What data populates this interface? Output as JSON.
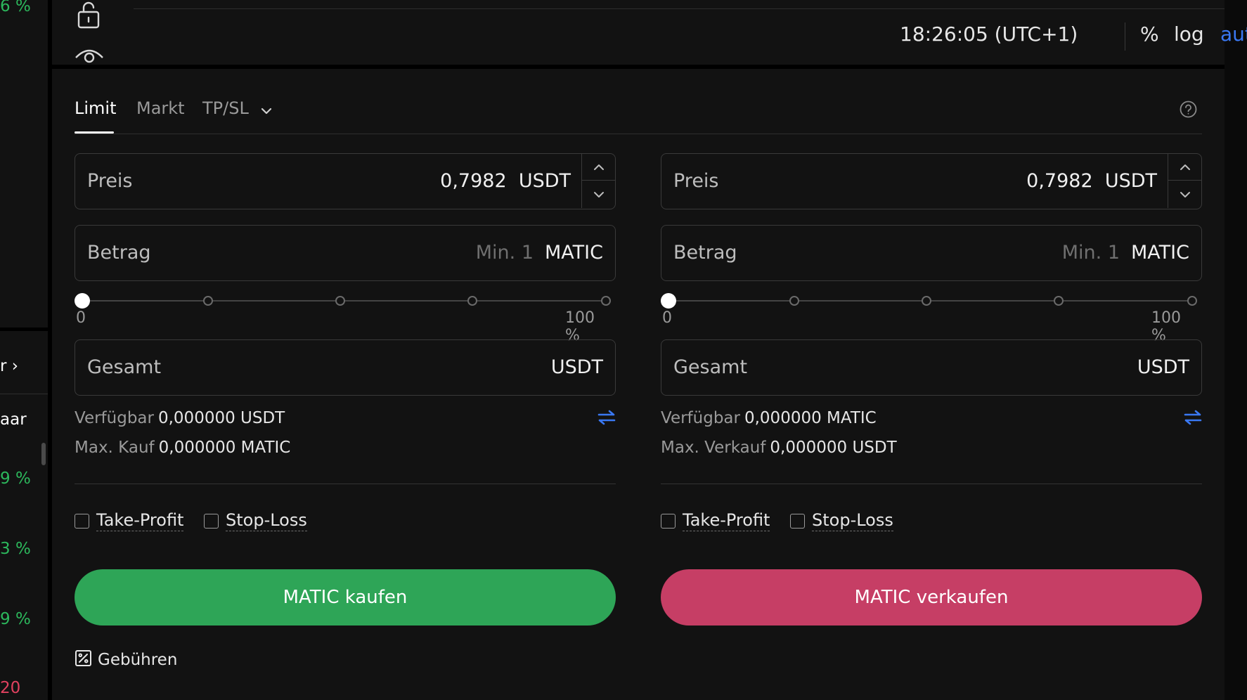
{
  "left_strip": {
    "items": [
      {
        "text": "6 %",
        "color": "green"
      },
      {
        "text": "r ›",
        "color": "white"
      },
      {
        "text": "aar",
        "color": "white"
      },
      {
        "text": "9 %",
        "color": "green"
      },
      {
        "text": "3 %",
        "color": "green"
      },
      {
        "text": "9 %",
        "color": "green"
      },
      {
        "text": "20",
        "color": "red"
      }
    ]
  },
  "topbar": {
    "time": "18:26:05 (UTC+1)",
    "options": [
      "%",
      "log",
      "auto"
    ],
    "active_option": "auto",
    "icons": [
      "unlock-icon",
      "eye-icon"
    ]
  },
  "tabs": {
    "items": [
      "Limit",
      "Markt",
      "TP/SL"
    ],
    "active": "Limit",
    "help_icon": "help-icon"
  },
  "buy": {
    "price": {
      "label": "Preis",
      "value": "0,7982",
      "unit": "USDT"
    },
    "amount": {
      "label": "Betrag",
      "placeholder": "Min. 1",
      "unit": "MATIC"
    },
    "slider": {
      "min_label": "0",
      "max_label": "100 %",
      "value_percent": 0
    },
    "total": {
      "label": "Gesamt",
      "unit": "USDT"
    },
    "available": {
      "label": "Verfügbar",
      "value": "0,000000 USDT"
    },
    "max": {
      "label": "Max. Kauf",
      "value": "0,000000 MATIC"
    },
    "take_profit": "Take-Profit",
    "stop_loss": "Stop-Loss",
    "button": "MATIC kaufen",
    "button_color": "#2ea557"
  },
  "sell": {
    "price": {
      "label": "Preis",
      "value": "0,7982",
      "unit": "USDT"
    },
    "amount": {
      "label": "Betrag",
      "placeholder": "Min. 1",
      "unit": "MATIC"
    },
    "slider": {
      "min_label": "0",
      "max_label": "100 %",
      "value_percent": 0
    },
    "total": {
      "label": "Gesamt",
      "unit": "USDT"
    },
    "available": {
      "label": "Verfügbar",
      "value": "0,000000 MATIC"
    },
    "max": {
      "label": "Max. Verkauf",
      "value": "0,000000 USDT"
    },
    "take_profit": "Take-Profit",
    "stop_loss": "Stop-Loss",
    "button": "MATIC verkaufen",
    "button_color": "#c63e65"
  },
  "fees": {
    "label": "Gebühren"
  },
  "colors": {
    "accent": "#3a78f2",
    "buy": "#2ea557",
    "sell": "#c63e65",
    "positive": "#2cb85c",
    "negative": "#e0415f"
  }
}
